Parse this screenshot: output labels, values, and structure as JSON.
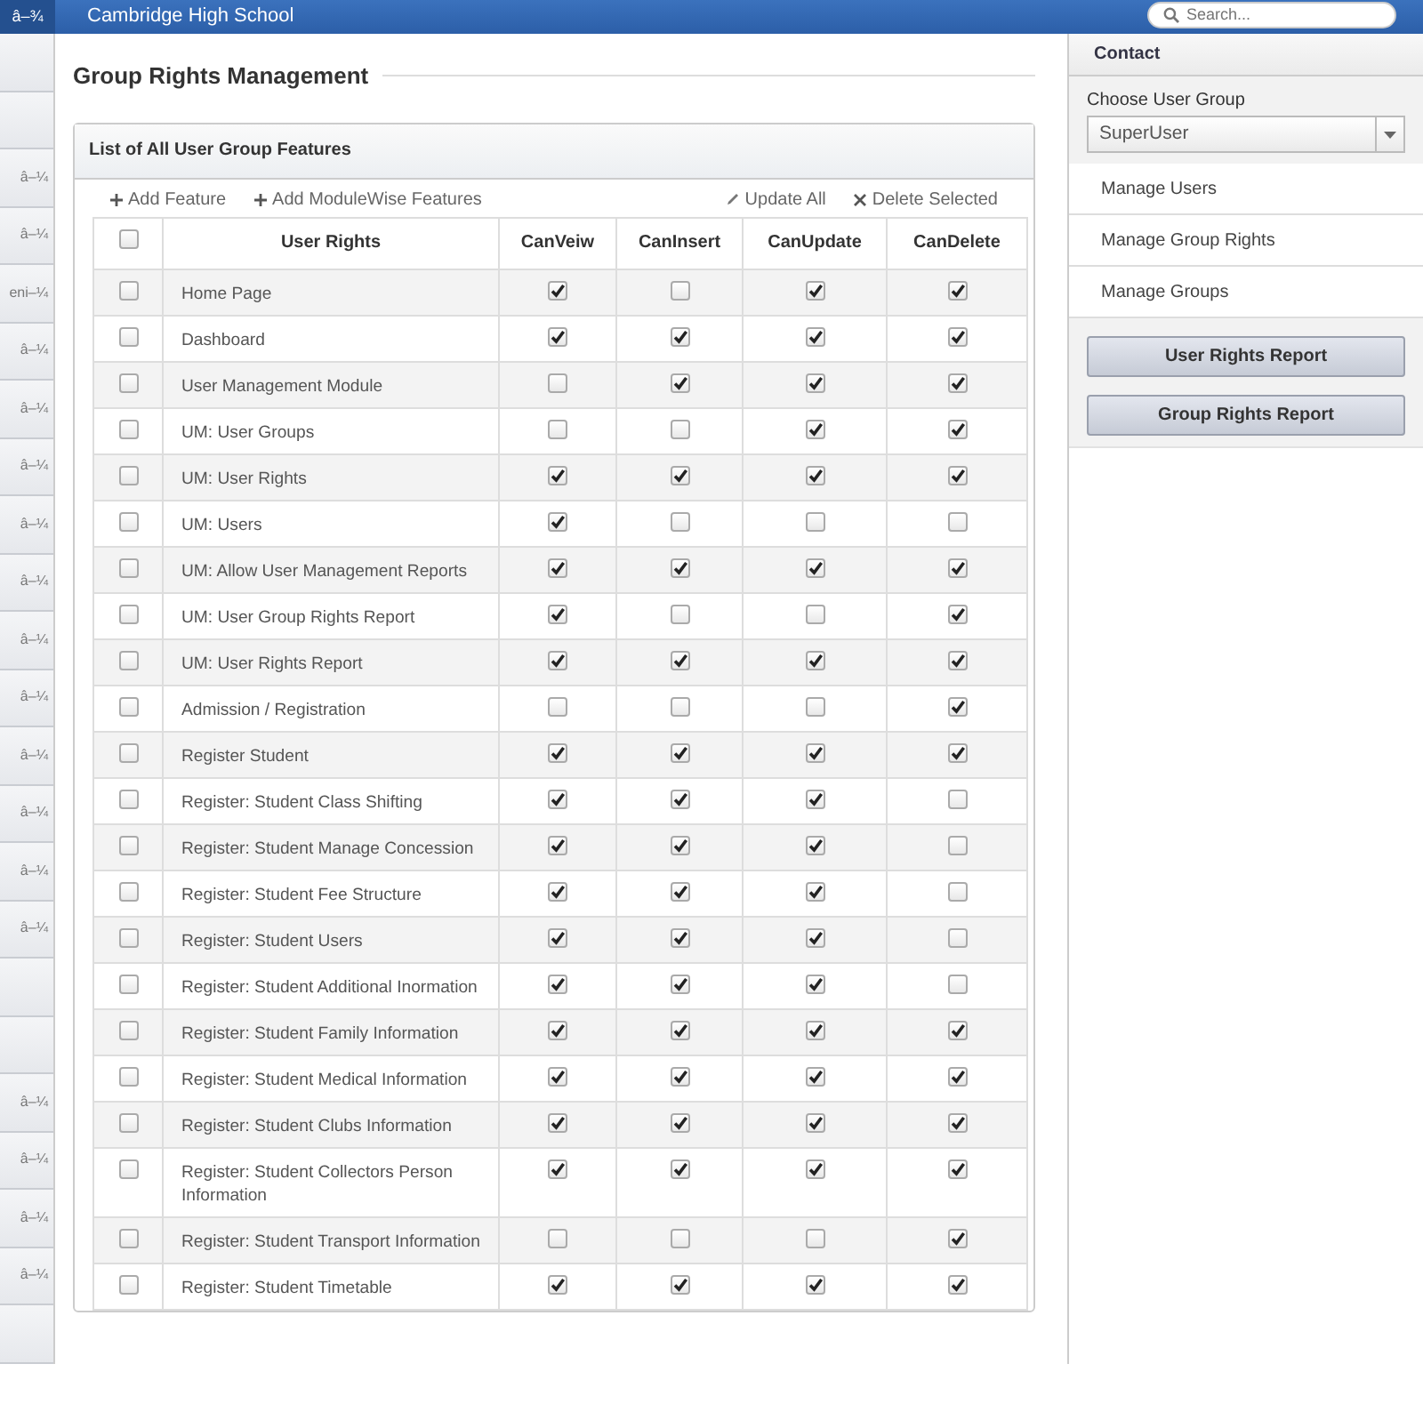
{
  "navbar": {
    "caret": "â–¾",
    "title": "Cambridge High School",
    "search": {
      "placeholder": "Search..."
    }
  },
  "left_menu": [
    {
      "kind": "blank"
    },
    {
      "kind": "blank"
    },
    {
      "kind": "label",
      "label": "â–¼"
    },
    {
      "kind": "label",
      "label": "â–¼"
    },
    {
      "kind": "label",
      "label": "eni–¼"
    },
    {
      "kind": "label",
      "label": "â–¼"
    },
    {
      "kind": "label",
      "label": "â–¼"
    },
    {
      "kind": "label",
      "label": "â–¼"
    },
    {
      "kind": "label",
      "label": "â–¼"
    },
    {
      "kind": "label",
      "label": "â–¼"
    },
    {
      "kind": "label",
      "label": "â–¼"
    },
    {
      "kind": "label",
      "label": "â–¼"
    },
    {
      "kind": "label",
      "label": "â–¼"
    },
    {
      "kind": "label",
      "label": "â–¼"
    },
    {
      "kind": "label",
      "label": "â–¼"
    },
    {
      "kind": "label",
      "label": "â–¼"
    },
    {
      "kind": "blank"
    },
    {
      "kind": "blank"
    },
    {
      "kind": "label",
      "label": "â–¼"
    },
    {
      "kind": "label",
      "label": "â–¼"
    },
    {
      "kind": "label",
      "label": "â–¼"
    },
    {
      "kind": "label",
      "label": "â–¼"
    },
    {
      "kind": "blank"
    }
  ],
  "page_title": "Group Rights Management",
  "panel": {
    "title": "List of All User Group Features",
    "toolbar": [
      {
        "kind": "add",
        "label": "Add Feature"
      },
      {
        "kind": "add",
        "label": "Add ModuleWise Features"
      },
      {
        "kind": "edit",
        "label": "Update All"
      },
      {
        "kind": "delete",
        "label": "Delete Selected"
      }
    ],
    "select_all": {
      "checked": false
    },
    "columns": [
      "User Rights",
      "CanVeiw",
      "CanInsert",
      "CanUpdate",
      "CanDelete"
    ],
    "rows": [
      {
        "name": "Home Page",
        "checked": false,
        "view": true,
        "insert": false,
        "update": true,
        "delete": true
      },
      {
        "name": "Dashboard",
        "checked": false,
        "view": true,
        "insert": true,
        "update": true,
        "delete": true
      },
      {
        "name": "User Management Module",
        "checked": false,
        "view": false,
        "insert": true,
        "update": true,
        "delete": true
      },
      {
        "name": "UM: User Groups",
        "checked": false,
        "view": false,
        "insert": false,
        "update": true,
        "delete": true
      },
      {
        "name": "UM: User Rights",
        "checked": false,
        "view": true,
        "insert": true,
        "update": true,
        "delete": true
      },
      {
        "name": "UM: Users",
        "checked": false,
        "view": true,
        "insert": false,
        "update": false,
        "delete": false
      },
      {
        "name": "UM: Allow User Management Reports",
        "checked": false,
        "view": true,
        "insert": true,
        "update": true,
        "delete": true
      },
      {
        "name": "UM: User Group Rights Report",
        "checked": false,
        "view": true,
        "insert": false,
        "update": false,
        "delete": true
      },
      {
        "name": "UM: User Rights Report",
        "checked": false,
        "view": true,
        "insert": true,
        "update": true,
        "delete": true
      },
      {
        "name": "Admission / Registration",
        "checked": false,
        "view": false,
        "insert": false,
        "update": false,
        "delete": true
      },
      {
        "name": "Register Student",
        "checked": false,
        "view": true,
        "insert": true,
        "update": true,
        "delete": true
      },
      {
        "name": "Register: Student Class Shifting",
        "checked": false,
        "view": true,
        "insert": true,
        "update": true,
        "delete": false
      },
      {
        "name": "Register: Student Manage Concession",
        "checked": false,
        "view": true,
        "insert": true,
        "update": true,
        "delete": false
      },
      {
        "name": "Register: Student Fee Structure",
        "checked": false,
        "view": true,
        "insert": true,
        "update": true,
        "delete": false
      },
      {
        "name": "Register: Student Users",
        "checked": false,
        "view": true,
        "insert": true,
        "update": true,
        "delete": false
      },
      {
        "name": "Register: Student Additional Inormation",
        "checked": false,
        "view": true,
        "insert": true,
        "update": true,
        "delete": false
      },
      {
        "name": "Register: Student Family Information",
        "checked": false,
        "view": true,
        "insert": true,
        "update": true,
        "delete": true
      },
      {
        "name": "Register: Student Medical Information",
        "checked": false,
        "view": true,
        "insert": true,
        "update": true,
        "delete": true
      },
      {
        "name": "Register: Student Clubs Information",
        "checked": false,
        "view": true,
        "insert": true,
        "update": true,
        "delete": true
      },
      {
        "name": "Register: Student Collectors Person Information",
        "checked": false,
        "view": true,
        "insert": true,
        "update": true,
        "delete": true
      },
      {
        "name": "Register: Student Transport Information",
        "checked": false,
        "view": false,
        "insert": false,
        "update": false,
        "delete": true
      },
      {
        "name": "Register: Student Timetable",
        "checked": false,
        "view": true,
        "insert": true,
        "update": true,
        "delete": true
      }
    ]
  },
  "sidebar": {
    "title": "Contact",
    "group_label": "Choose User Group",
    "group_value": "SuperUser",
    "links": [
      "Manage Users",
      "Manage Group Rights",
      "Manage Groups"
    ],
    "buttons": [
      "User Rights Report",
      "Group Rights Report"
    ]
  }
}
